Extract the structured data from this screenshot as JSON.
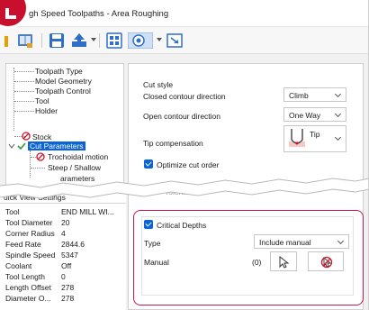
{
  "window": {
    "title": "gh Speed Toolpaths - Area Roughing"
  },
  "toolbar": {
    "icons": [
      "open-book-icon",
      "save-icon",
      "export-icon",
      "calculator-icon",
      "view-mode-icon",
      "frame-icon"
    ]
  },
  "tree": {
    "items": [
      {
        "label": "Toolpath Type"
      },
      {
        "label": "Model Geometry"
      },
      {
        "label": "Toolpath Control"
      },
      {
        "label": "Tool"
      },
      {
        "label": "Holder"
      },
      {
        "label": "Stock"
      },
      {
        "label": "Cut Parameters"
      },
      {
        "label": "Trochoidal motion"
      },
      {
        "label": "Steep / Shallow"
      },
      {
        "label": "arameters"
      }
    ]
  },
  "quick_view": {
    "header": "uick View Settings",
    "rows": [
      {
        "key": "Tool",
        "value": "END MILL WI..."
      },
      {
        "key": "Tool Diameter",
        "value": "20"
      },
      {
        "key": "Corner Radius",
        "value": "4"
      },
      {
        "key": "Feed Rate",
        "value": "2844.6"
      },
      {
        "key": "Spindle Speed",
        "value": "5347"
      },
      {
        "key": "Coolant",
        "value": "Off"
      },
      {
        "key": "Tool Length",
        "value": "0"
      },
      {
        "key": "Length Offset",
        "value": "278"
      },
      {
        "key": "Diameter O...",
        "value": "278"
      }
    ]
  },
  "cut_style": {
    "title": "Cut style",
    "closed_label": "Closed contour direction",
    "closed_value": "Climb",
    "open_label": "Open contour direction",
    "open_value": "One Way",
    "tip_label": "Tip compensation",
    "tip_value": "Tip",
    "optimize_label": "Optimize cut order",
    "tolerance_label": "Tolerance"
  },
  "critical_depths": {
    "title": "Critical Depths",
    "type_label": "Type",
    "type_value": "Include manual",
    "manual_label": "Manual",
    "manual_count": "(0)"
  },
  "colors": {
    "accent": "#0a64d6",
    "highlight": "#c8174a",
    "brand": "#c8102e"
  }
}
